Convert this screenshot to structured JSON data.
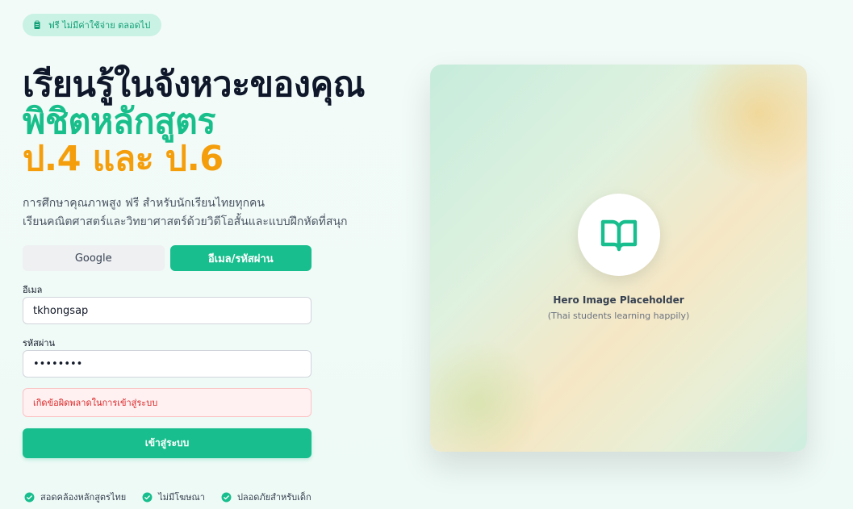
{
  "badge": {
    "text": "ฟรี ไม่มีค่าใช้จ่าย ตลอดไป",
    "icon": "clipboard-icon"
  },
  "headline": {
    "part1": "เรียนรู้ในจังหวะของคุณ ",
    "part2": "พิชิตหลักสูตร",
    "part3": "ป.4 และ ป.6"
  },
  "subtitle": {
    "line1": "การศึกษาคุณภาพสูง ฟรี สำหรับนักเรียนไทยทุกคน",
    "line2": "เรียนคณิตศาสตร์และวิทยาศาสตร์ด้วยวิดีโอสั้นและแบบฝึกหัดที่สนุก"
  },
  "tabs": {
    "google": "Google",
    "email": "อีเมล/รหัสผ่าน"
  },
  "form": {
    "email_label": "อีเมล",
    "email_value": "tkhongsap",
    "password_label": "รหัสผ่าน",
    "password_value": "password",
    "error": "เกิดข้อผิดพลาดในการเข้าสู่ระบบ",
    "submit": "เข้าสู่ระบบ"
  },
  "features": [
    {
      "text": "สอดคล้องหลักสูตรไทย",
      "icon": "check-circle-icon"
    },
    {
      "text": "ไม่มีโฆษณา",
      "icon": "check-circle-icon"
    },
    {
      "text": "ปลอดภัยสำหรับเด็ก",
      "icon": "check-circle-icon"
    }
  ],
  "hero": {
    "title": "Hero Image Placeholder",
    "subtitle": "(Thai students learning happily)",
    "icon": "book-open-icon"
  },
  "colors": {
    "accent": "#18be8d",
    "orange": "#f59e0b",
    "error": "#dc2626"
  }
}
